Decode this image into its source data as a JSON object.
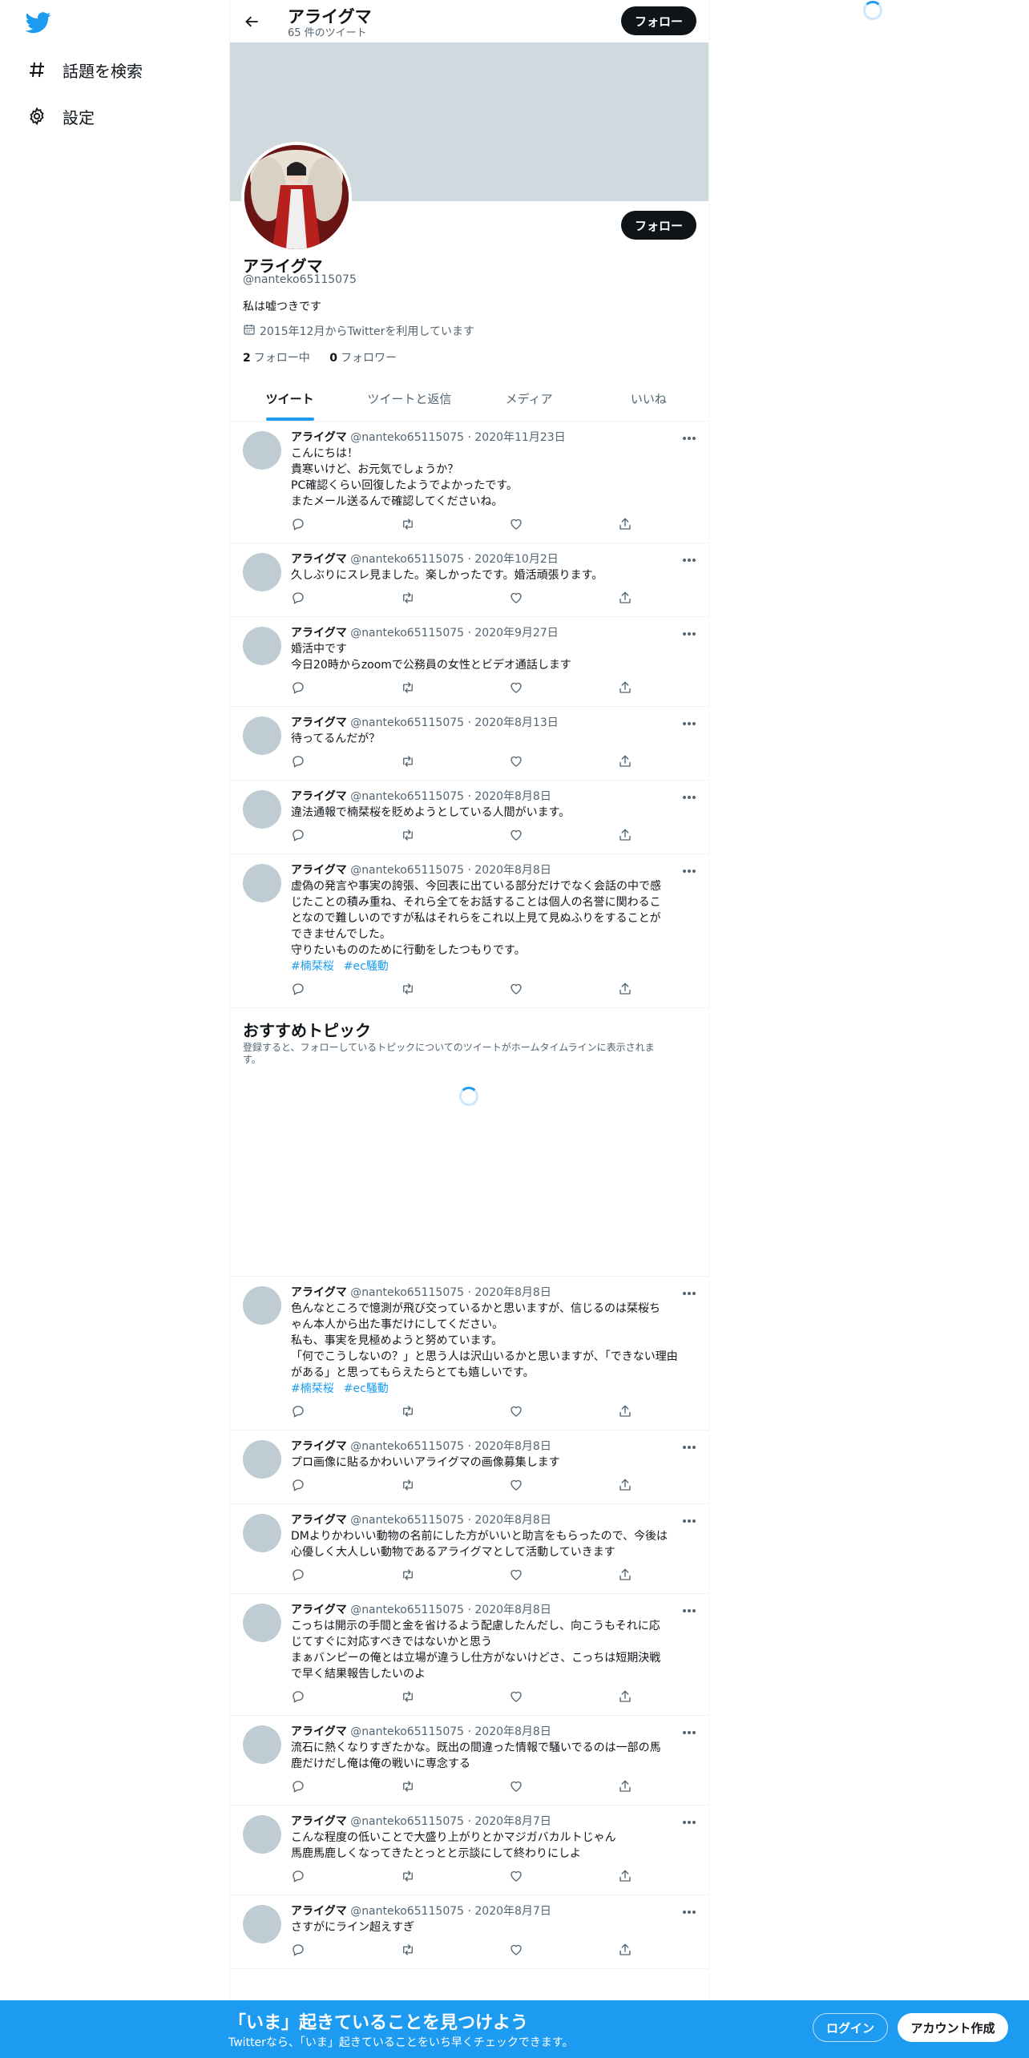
{
  "nav": {
    "items": [
      {
        "label": "話題を検索",
        "icon": "hashtag-icon"
      },
      {
        "label": "設定",
        "icon": "gear-icon"
      }
    ]
  },
  "header": {
    "name": "アライグマ",
    "tweet_count": "65 件のツイート",
    "follow_label": "フォロー"
  },
  "profile": {
    "name": "アライグマ",
    "handle": "@nanteko65115075",
    "bio": "私は嘘つきです",
    "joined": "2015年12月からTwitterを利用しています",
    "following_count": "2",
    "following_label": "フォロー中",
    "followers_count": "0",
    "followers_label": "フォロワー",
    "follow_label": "フォロー"
  },
  "tabs": [
    {
      "label": "ツイート",
      "active": true
    },
    {
      "label": "ツイートと返信",
      "active": false
    },
    {
      "label": "メディア",
      "active": false
    },
    {
      "label": "いいね",
      "active": false
    }
  ],
  "tweets_before": [
    {
      "name": "アライグマ",
      "meta": "@nanteko65115075 · 2020年11月23日",
      "text": "こんにちは！\n貴寒いけど、お元気でしょうか？\nPC確認くらい回復したようでよかったです。\nまたメール送るんで確認してくださいね。",
      "tags": []
    },
    {
      "name": "アライグマ",
      "meta": "@nanteko65115075 · 2020年10月2日",
      "text": "久しぶりにスレ見ました。楽しかったです。婚活頑張ります。",
      "tags": []
    },
    {
      "name": "アライグマ",
      "meta": "@nanteko65115075 · 2020年9月27日",
      "text": "婚活中です\n今日20時からzoomで公務員の女性とビデオ通話します",
      "tags": []
    },
    {
      "name": "アライグマ",
      "meta": "@nanteko65115075 · 2020年8月13日",
      "text": "待ってるんだが？",
      "tags": []
    },
    {
      "name": "アライグマ",
      "meta": "@nanteko65115075 · 2020年8月8日",
      "text": "違法通報で楠栞桜を貶めようとしている人間がいます。",
      "tags": []
    },
    {
      "name": "アライグマ",
      "meta": "@nanteko65115075 · 2020年8月8日",
      "text": "虚偽の発言や事実の誇張、今回表に出ている部分だけでなく会話の中で感\nじたことの積み重ね、それら全てをお話することは個人の名誉に関わるこ\nとなので難しいのですが私はそれらをこれ以上見て見ぬふりをすることが\nできませんでした。\n守りたいもののために行動をしたつもりです。",
      "tags": [
        "#楠栞桜",
        "#ec騒動"
      ]
    }
  ],
  "topics": {
    "title": "おすすめトピック",
    "description": "登録すると、フォローしているトピックについてのツイートがホームタイムラインに表示されま\nす。"
  },
  "tweets_after": [
    {
      "name": "アライグマ",
      "meta": "@nanteko65115075 · 2020年8月8日",
      "text": "色んなところで憶測が飛び交っているかと思いますが、信じるのは栞桜ち\nゃん本人から出た事だけにしてください。\n私も、事実を見極めようと努めています。\n「何でこうしないの？」と思う人は沢山いるかと思いますが、「できない理由\nがある」と思ってもらえたらとても嬉しいです。",
      "tags": [
        "#楠栞桜",
        "#ec騒動"
      ]
    },
    {
      "name": "アライグマ",
      "meta": "@nanteko65115075 · 2020年8月8日",
      "text": "プロ画像に貼るかわいいアライグマの画像募集します",
      "tags": []
    },
    {
      "name": "アライグマ",
      "meta": "@nanteko65115075 · 2020年8月8日",
      "text": "DMよりかわいい動物の名前にした方がいいと助言をもらったので、今後は\n心優しく大人しい動物であるアライグマとして活動していきます",
      "tags": []
    },
    {
      "name": "アライグマ",
      "meta": "@nanteko65115075 · 2020年8月8日",
      "text": "こっちは開示の手間と金を省けるよう配慮したんだし、向こうもそれに応\nじてすぐに対応すべきではないかと思う\nまぁバンピーの俺とは立場が違うし仕方がないけどさ、こっちは短期決戦\nで早く結果報告したいのよ",
      "tags": []
    },
    {
      "name": "アライグマ",
      "meta": "@nanteko65115075 · 2020年8月8日",
      "text": "流石に熱くなりすぎたかな。既出の間違った情報で騒いでるのは一部の馬\n鹿だけだし俺は俺の戦いに専念する",
      "tags": []
    },
    {
      "name": "アライグマ",
      "meta": "@nanteko65115075 · 2020年8月7日",
      "text": "こんな程度の低いことで大盛り上がりとかマジガバカルトじゃん\n馬鹿馬鹿しくなってきたとっとと示談にして終わりにしよ",
      "tags": []
    },
    {
      "name": "アライグマ",
      "meta": "@nanteko65115075 · 2020年8月7日",
      "text": "さすがにライン超えすぎ",
      "tags": []
    }
  ],
  "bottom_bar": {
    "title": "「いま」起きていることを見つけよう",
    "subtitle": "Twitterなら、「いま」起きていることをいち早くチェックできます。",
    "login_label": "ログイン",
    "signup_label": "アカウント作成"
  },
  "colors": {
    "accent": "#1d9bf0",
    "text": "#0f1419",
    "muted": "#536471",
    "banner": "#cfd9de"
  }
}
